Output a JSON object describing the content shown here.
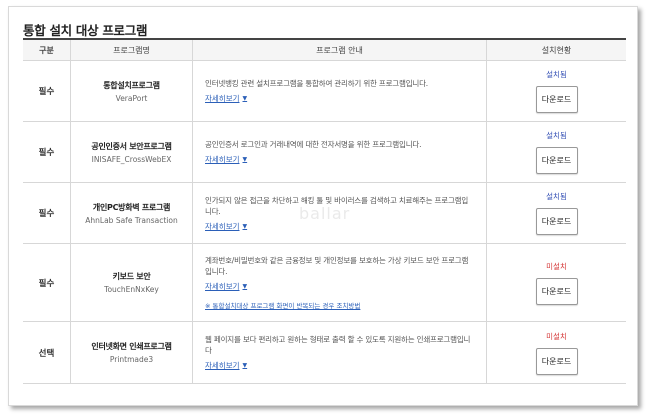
{
  "title": "통합 설치 대상 프로그램",
  "headers": {
    "col1": "구분",
    "col2": "프로그램명",
    "col3": "프로그램 안내",
    "col4": "설치현황"
  },
  "programs": [
    {
      "category": "필수",
      "name_ko": "통합설치프로그램",
      "name_en": "VeraPort",
      "desc": "인터넷뱅킹 관련 설치프로그램을 통합하여 관리하기 위한 프로그램입니다.",
      "more": "자세히보기",
      "status": "설치됨",
      "button": "다운로드"
    },
    {
      "category": "필수",
      "name_ko": "공인인증서 보안프로그램",
      "name_en": "INISAFE_CrossWebEX",
      "desc": "공인인증서 로그인과 거래내역에 대한 전자서명을 위한 프로그램입니다.",
      "more": "자세히보기",
      "status": "설치됨",
      "button": "다운로드"
    },
    {
      "category": "필수",
      "name_ko": "개인PC방화벽 프로그램",
      "name_en": "AhnLab Safe Transaction",
      "desc": "인가되지 않은 접근을 차단하고 해킹 툴 및 바이러스를 검색하고 치료해주는 프로그램입니다.",
      "more": "자세히보기",
      "status": "설치됨",
      "button": "다운로드"
    },
    {
      "category": "필수",
      "name_ko": "키보드 보안",
      "name_en": "TouchEnNxKey",
      "desc": "계좌번호/비밀번호와 같은 금융정보 및 개인정보를 보호하는 가상 키보드 보안 프로그램입니다.",
      "more": "자세히보기",
      "note": "※ 통합설치대상 프로그램 화면이 반복되는 경우 조치방법",
      "status": "미설치",
      "button": "다운로드"
    },
    {
      "category": "선택",
      "name_ko": "인터넷화면 인쇄프로그램",
      "name_en": "Printmade3",
      "desc": "웹 페이지를 보다 편리하고 원하는 형태로 출력 할 수 있도록 지원하는 인쇄프로그램입니다",
      "more": "자세히보기",
      "status": "미설치",
      "button": "다운로드"
    }
  ],
  "colors": {
    "installed": "#3a55b7",
    "not_installed": "#d63b3b",
    "link": "#2b5fb8"
  },
  "icons": {
    "more_caret": "caret-down-icon"
  }
}
